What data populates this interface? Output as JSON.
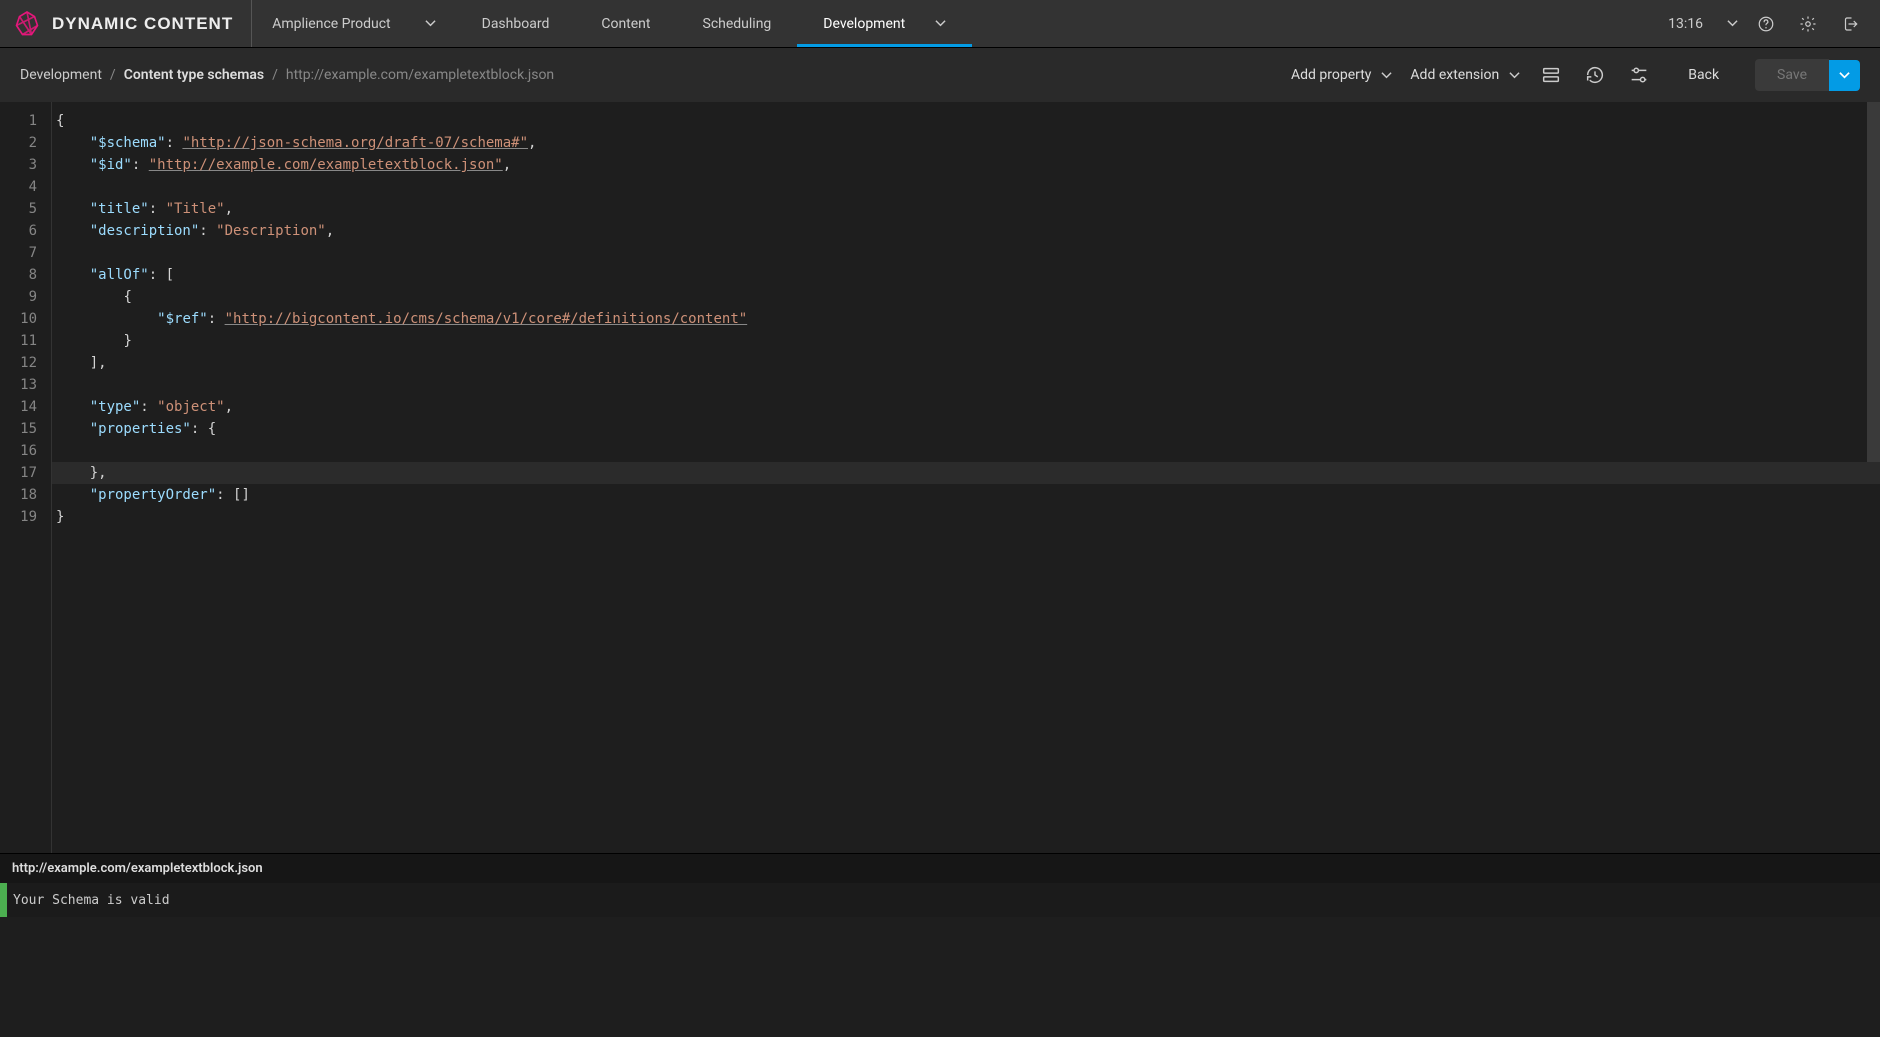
{
  "brand": {
    "name": "DYNAMIC CONTENT"
  },
  "workspace": {
    "label": "Amplience Product"
  },
  "nav": {
    "tabs": [
      {
        "label": "Dashboard"
      },
      {
        "label": "Content"
      },
      {
        "label": "Scheduling"
      },
      {
        "label": "Development",
        "has_menu": true,
        "active": true
      }
    ]
  },
  "clock": "13:16",
  "breadcrumb": {
    "a": "Development",
    "b": "Content type schemas",
    "c": "http://example.com/exampletextblock.json"
  },
  "toolbar": {
    "add_property": "Add property",
    "add_extension": "Add extension",
    "back": "Back",
    "save": "Save"
  },
  "editor": {
    "line_count": 19,
    "current_line": 17,
    "tokens": {
      "l2_key": "\"$schema\"",
      "l2_val": "\"http://json-schema.org/draft-07/schema#\"",
      "l3_key": "\"$id\"",
      "l3_val": "\"http://example.com/exampletextblock.json\"",
      "l5_key": "\"title\"",
      "l5_val": "\"Title\"",
      "l6_key": "\"description\"",
      "l6_val": "\"Description\"",
      "l8_key": "\"allOf\"",
      "l10_key": "\"$ref\"",
      "l10_val": "\"http://bigcontent.io/cms/schema/v1/core#/definitions/content\"",
      "l14_key": "\"type\"",
      "l14_val": "\"object\"",
      "l15_key": "\"properties\"",
      "l18_key": "\"propertyOrder\""
    }
  },
  "status": {
    "file": "http://example.com/exampletextblock.json",
    "message": "Your Schema is valid"
  }
}
